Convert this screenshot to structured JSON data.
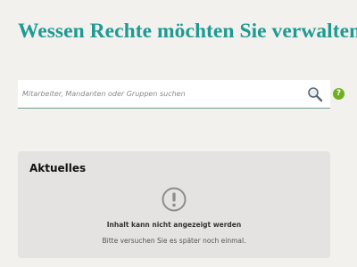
{
  "header": {
    "title": "Wessen Rechte möchten Sie verwalten?"
  },
  "search": {
    "placeholder": "Mitarbeiter, Mandanten oder Gruppen suchen",
    "value": "",
    "icon": "search-icon"
  },
  "help": {
    "label": "?",
    "icon": "help-icon",
    "color": "#6fb01f"
  },
  "news_card": {
    "title": "Aktuelles",
    "icon": "warning-icon",
    "error_title": "Inhalt kann nicht angezeigt werden",
    "error_message": "Bitte versuchen Sie es später noch einmal."
  },
  "colors": {
    "accent": "#1f9a93",
    "background": "#f2f1ee",
    "card_background": "#e4e3e1"
  }
}
